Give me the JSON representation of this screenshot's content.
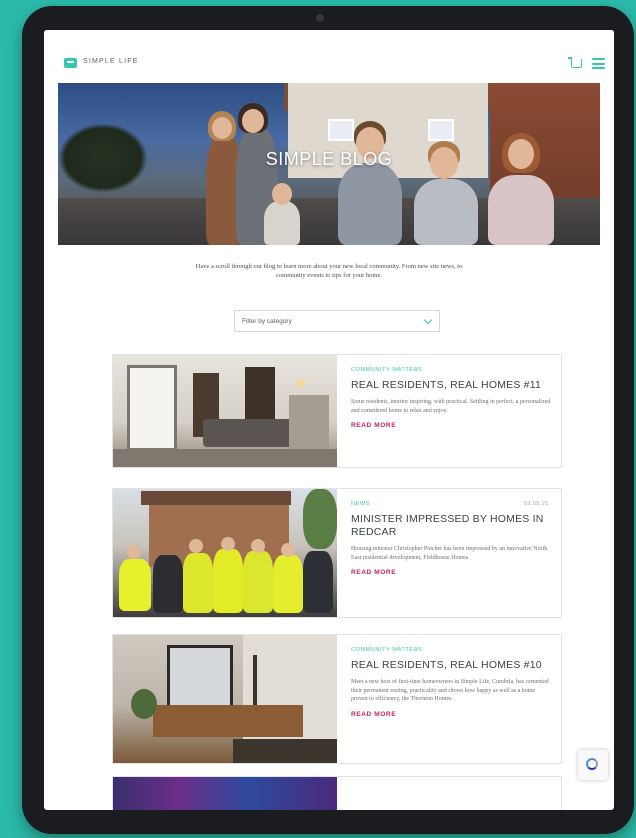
{
  "header": {
    "logo_text": "SIMPLE LIFE"
  },
  "hero": {
    "title": "SIMPLE BLOG"
  },
  "intro": {
    "text": "Have a scroll through our blog to learn more about your new local community. From new site news, to community events to tips for your home."
  },
  "filter": {
    "placeholder": "Filter by category"
  },
  "posts": [
    {
      "category": "Community Matters",
      "date": "",
      "title": "REAL RESIDENTS, REAL HOMES #11",
      "excerpt": "Some residents, interior inspiring, with practical. Settling in perfect, a personalized and considered home to relax and enjoy.",
      "link": "READ MORE"
    },
    {
      "category": "News",
      "date": "03.05.21",
      "title": "MINISTER IMPRESSED BY HOMES IN REDCAR",
      "excerpt": "Housing minister Christopher Pincher has been impressed by an innovative North East residential development, Fieldhouse Homes.",
      "link": "READ MORE"
    },
    {
      "category": "Community Matters",
      "date": "",
      "title": "REAL RESIDENTS, REAL HOMES #10",
      "excerpt": "Meet a new host of first-time homeowners in Simple Life, Cumbria, has cemented their permanent resting, practicality and shows how happy as well as a home proven to efficiency, the Thornton Homes.",
      "link": "READ MORE"
    }
  ]
}
